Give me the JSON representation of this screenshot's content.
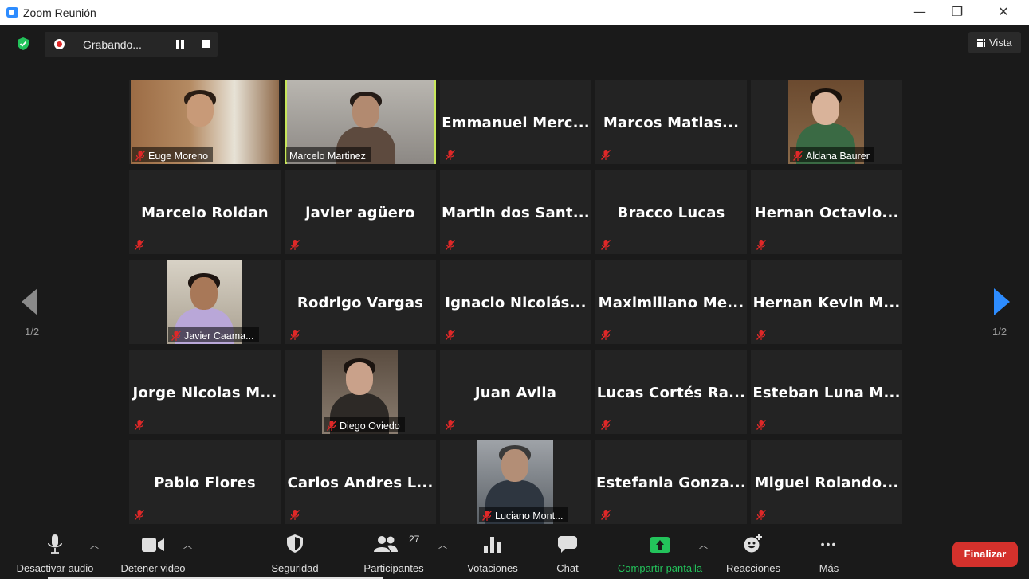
{
  "window": {
    "title": "Zoom Reunión",
    "minimize": "—",
    "maximize": "❐",
    "close": "✕"
  },
  "recording": {
    "label": "Grabando..."
  },
  "view_button": {
    "label": "Vista"
  },
  "pagination": {
    "left": "1/2",
    "right": "1/2"
  },
  "colors": {
    "accent": "#2d8cff",
    "active_speaker": "#c7e65a",
    "end_button": "#d4312c",
    "security_green": "#23c35b",
    "share_green": "#23c35b"
  },
  "participants": [
    {
      "name": "Euge Moreno",
      "video": true
    },
    {
      "name": "Marcelo Martinez",
      "video": true,
      "active": true
    },
    {
      "name": "Emmanuel Merc...",
      "video": false
    },
    {
      "name": "Marcos Matias...",
      "video": false
    },
    {
      "name": "Aldana Baurer",
      "video": true
    },
    {
      "name": "Marcelo Roldan",
      "video": false
    },
    {
      "name": "javier agüero",
      "video": false
    },
    {
      "name": "Martin dos Sant...",
      "video": false
    },
    {
      "name": "Bracco Lucas",
      "video": false
    },
    {
      "name": "Hernan Octavio...",
      "video": false
    },
    {
      "name": "Javier Caama...",
      "video": true
    },
    {
      "name": "Rodrigo Vargas",
      "video": false
    },
    {
      "name": "Ignacio Nicolás...",
      "video": false
    },
    {
      "name": "Maximiliano Me...",
      "video": false
    },
    {
      "name": "Hernan Kevin M...",
      "video": false
    },
    {
      "name": "Jorge Nicolas M...",
      "video": false
    },
    {
      "name": "Diego Oviedo",
      "video": true
    },
    {
      "name": "Juan Avila",
      "video": false
    },
    {
      "name": "Lucas Cortés Ra...",
      "video": false
    },
    {
      "name": "Esteban Luna M...",
      "video": false
    },
    {
      "name": "Pablo Flores",
      "video": false
    },
    {
      "name": "Carlos Andres L...",
      "video": false
    },
    {
      "name": "Luciano Mont...",
      "video": true
    },
    {
      "name": "Estefania Gonza...",
      "video": false
    },
    {
      "name": "Miguel Rolando...",
      "video": false
    }
  ],
  "toolbar": {
    "audio": "Desactivar audio",
    "video": "Detener video",
    "security": "Seguridad",
    "participants": "Participantes",
    "participants_count": "27",
    "polls": "Votaciones",
    "chat": "Chat",
    "share": "Compartir pantalla",
    "reactions": "Reacciones",
    "more": "Más",
    "more_glyph": "•••",
    "end": "Finalizar"
  }
}
